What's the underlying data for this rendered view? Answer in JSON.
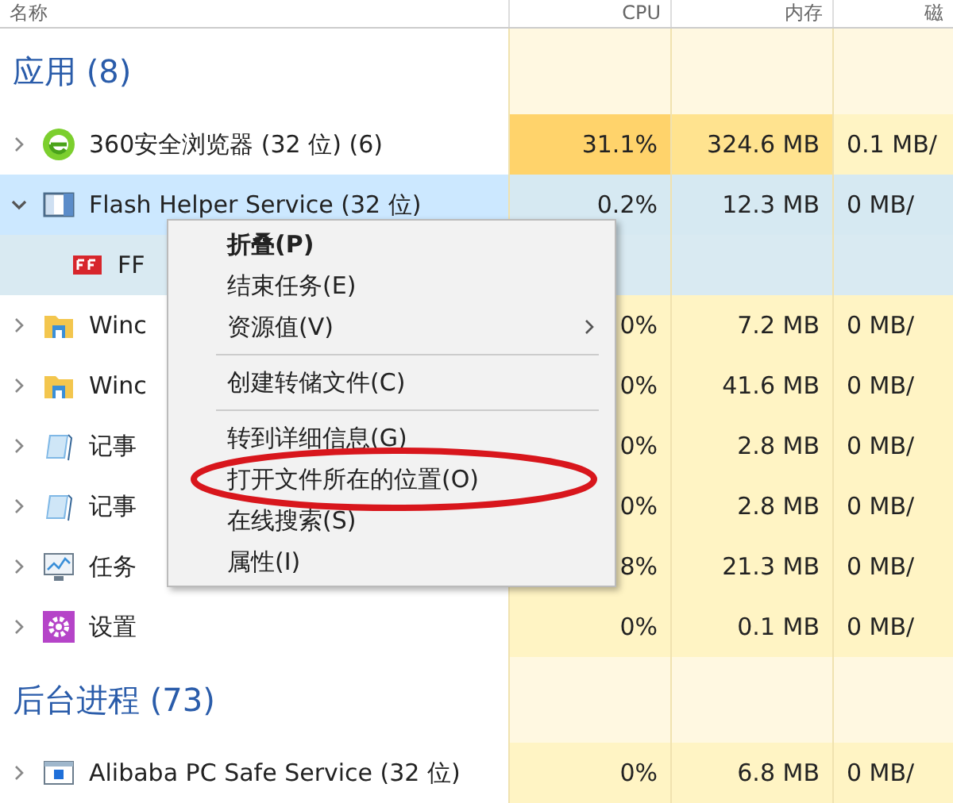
{
  "header": {
    "columns": [
      "名称",
      "CPU",
      "内存",
      "磁"
    ]
  },
  "sections": [
    {
      "title": "应用 (8)",
      "rows": [
        {
          "kind": "browser",
          "name": "360安全浏览器 (32 位) (6)",
          "expanded": false,
          "selected": false,
          "cpu": "31.1%",
          "memory": "324.6 MB",
          "disk": "0.1 MB/"
        },
        {
          "kind": "service",
          "name": "Flash Helper Service (32 位)",
          "expanded": true,
          "selected": true,
          "cpu": "0.2%",
          "memory": "12.3 MB",
          "disk": "0 MB/",
          "children": [
            {
              "kind": "flash",
              "name": "FF",
              "selected": false
            }
          ]
        },
        {
          "kind": "folder",
          "name": "Winc",
          "expanded": false,
          "selected": false,
          "cpu": "0%",
          "memory": "7.2 MB",
          "disk": "0 MB/"
        },
        {
          "kind": "folder",
          "name": "Winc",
          "expanded": false,
          "selected": false,
          "cpu": "0%",
          "memory": "41.6 MB",
          "disk": "0 MB/"
        },
        {
          "kind": "notepad",
          "name": "记事",
          "expanded": false,
          "selected": false,
          "cpu": "0%",
          "memory": "2.8 MB",
          "disk": "0 MB/"
        },
        {
          "kind": "notepad",
          "name": "记事",
          "expanded": false,
          "selected": false,
          "cpu": "0%",
          "memory": "2.8 MB",
          "disk": "0 MB/"
        },
        {
          "kind": "monitor",
          "name": "任务",
          "expanded": false,
          "selected": false,
          "cpu": "8%",
          "memory": "21.3 MB",
          "disk": "0 MB/"
        },
        {
          "kind": "settings",
          "name": "设置",
          "expanded": false,
          "selected": false,
          "cpu": "0%",
          "memory": "0.1 MB",
          "disk": "0 MB/"
        }
      ]
    },
    {
      "title": "后台进程 (73)",
      "rows": [
        {
          "kind": "service-window",
          "name": "Alibaba PC Safe Service (32 位)",
          "expanded": false,
          "selected": false,
          "cpu": "0%",
          "memory": "6.8 MB",
          "disk": "0 MB/"
        }
      ]
    }
  ],
  "context_menu": {
    "items": [
      {
        "label": "折叠(P)",
        "default": true,
        "submenu": false,
        "separator_before": false,
        "circled": false
      },
      {
        "label": "结束任务(E)",
        "default": false,
        "submenu": false,
        "separator_before": false,
        "circled": false
      },
      {
        "label": "资源值(V)",
        "default": false,
        "submenu": true,
        "separator_before": false,
        "circled": false
      },
      {
        "label": "创建转储文件(C)",
        "default": false,
        "submenu": false,
        "separator_before": true,
        "circled": false
      },
      {
        "label": "转到详细信息(G)",
        "default": false,
        "submenu": false,
        "separator_before": true,
        "circled": false
      },
      {
        "label": "打开文件所在的位置(O)",
        "default": false,
        "submenu": false,
        "separator_before": false,
        "circled": true
      },
      {
        "label": "在线搜索(S)",
        "default": false,
        "submenu": false,
        "separator_before": false,
        "circled": false
      },
      {
        "label": "属性(I)",
        "default": false,
        "submenu": false,
        "separator_before": false,
        "circled": false
      }
    ]
  }
}
